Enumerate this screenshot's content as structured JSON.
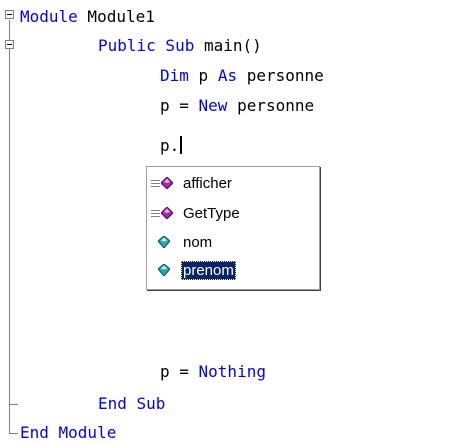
{
  "editor": {
    "lines": {
      "module_open": {
        "kw": "Module",
        "rest": " Module1"
      },
      "sub_open": {
        "kw": "Public Sub",
        "rest": " main()"
      },
      "dim": {
        "kw1": "Dim",
        "mid": " p ",
        "kw2": "As",
        "rest": " personne"
      },
      "assign_new": {
        "pre": "p = ",
        "kw": "New",
        "rest": " personne"
      },
      "member_access": {
        "text": "p."
      },
      "assign_nothing": {
        "pre": "p = ",
        "kw": "Nothing"
      },
      "sub_close": {
        "kw": "End Sub"
      },
      "module_close": {
        "kw": "End Module"
      }
    },
    "colors": {
      "keyword": "#0000ff",
      "text": "#000000",
      "selection": "#0a246a"
    }
  },
  "intellisense": {
    "items": [
      {
        "label": "afficher",
        "kind": "method",
        "icon": "method-icon"
      },
      {
        "label": "GetType",
        "kind": "method",
        "icon": "method-icon"
      },
      {
        "label": "nom",
        "kind": "field",
        "icon": "field-icon"
      },
      {
        "label": "prenom",
        "kind": "field",
        "icon": "field-icon",
        "selected": true
      }
    ]
  }
}
